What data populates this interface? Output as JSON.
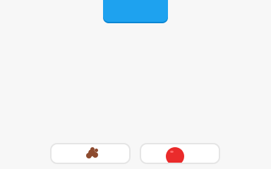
{
  "prompt_card": {
    "color": "#1ea2ef",
    "shadow": "#0b86d3"
  },
  "choices": [
    {
      "icon": "chocolate-cookie-icon",
      "color": "#8d4b2f"
    },
    {
      "icon": "red-apple-icon",
      "color": "#ea2b2b"
    }
  ]
}
